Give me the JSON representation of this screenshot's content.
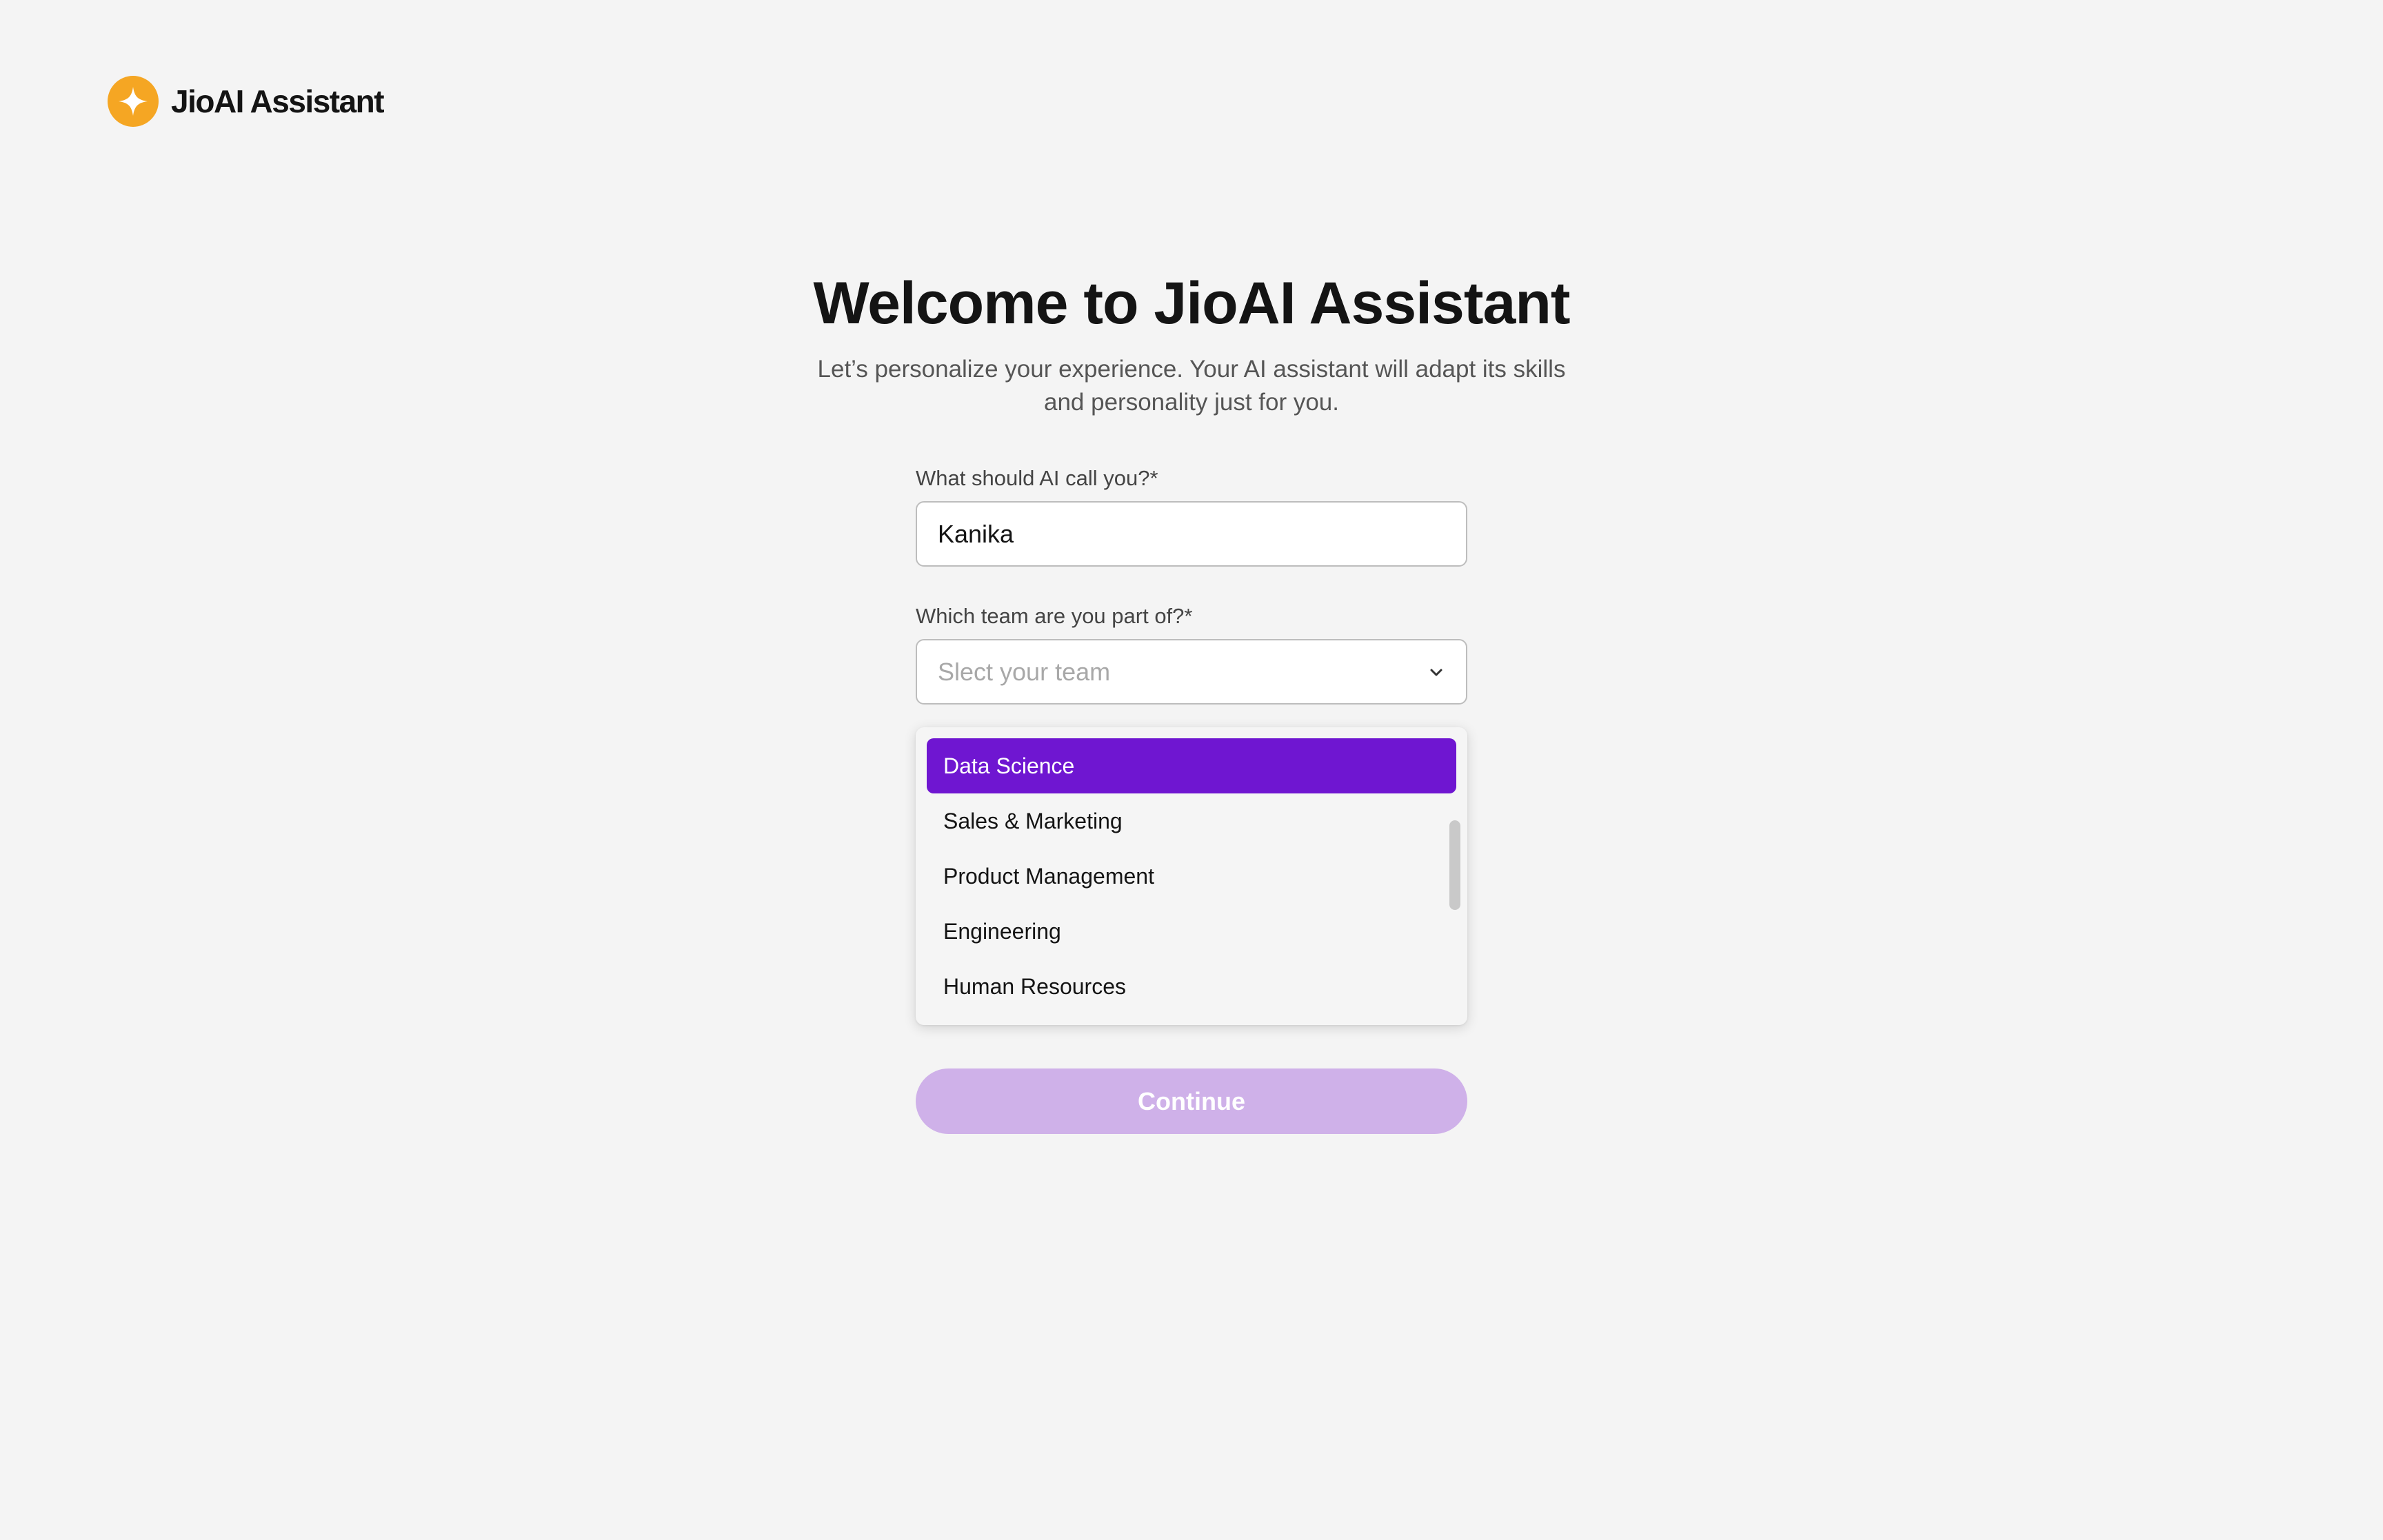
{
  "app": {
    "logo_text": "JioAI Assistant",
    "logo_icon": "sparkle-icon",
    "logo_color": "#f5a623"
  },
  "welcome": {
    "title": "Welcome to JioAI Assistant",
    "subtitle": "Let’s personalize your experience. Your AI assistant will adapt its skills and personality just for you."
  },
  "form": {
    "name_label": "What should AI call you?*",
    "name_value": "Kanika",
    "team_label": "Which team are you part of?*",
    "team_placeholder": "Slect your team",
    "team_icon": "chevron-down-icon",
    "team_options": [
      "Data Science",
      "Sales & Marketing",
      "Product Management",
      "Engineering",
      "Human Resources"
    ],
    "highlighted_option": "Data Science",
    "continue_label": "Continue"
  },
  "colors": {
    "accent": "#6f16d1",
    "button_disabled": "#cfb1e9",
    "background": "#f4f4f4"
  }
}
